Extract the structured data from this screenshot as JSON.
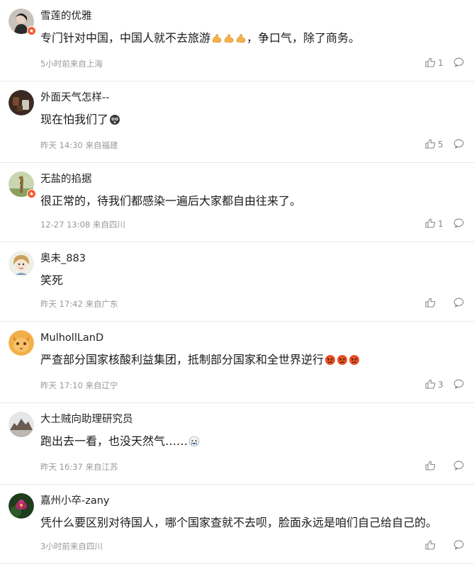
{
  "comments": [
    {
      "username": "雪莲的优雅",
      "text": "专门针对中国，中国人就不去旅游",
      "text_after": "，争口气，除了商务。",
      "emoji": "muscle-emoji",
      "emoji_count": 3,
      "meta": "5小时前来自上海",
      "likes": "1",
      "verified": true,
      "avatar": "woman-portrait"
    },
    {
      "username": "外面天气怎样--",
      "text": "现在怕我们了",
      "text_after": "",
      "emoji": "scared-emoji",
      "emoji_count": 1,
      "meta": "昨天 14:30 来自福建",
      "likes": "5",
      "verified": false,
      "avatar": "dark-photo"
    },
    {
      "username": "无盐的掐据",
      "text": "很正常的，待我们都感染一遍后大家都自由往来了。",
      "text_after": "",
      "emoji": "",
      "emoji_count": 0,
      "meta": "12-27 13:08 来自四川",
      "likes": "1",
      "verified": true,
      "avatar": "giraffe"
    },
    {
      "username": "奥未_883",
      "text": "笑死",
      "text_after": "",
      "emoji": "",
      "emoji_count": 0,
      "meta": "昨天 17:42 来自广东",
      "likes": "",
      "verified": false,
      "avatar": "cartoon-girl"
    },
    {
      "username": "MulhollLanD",
      "text": "严查部分国家核酸利益集团，抵制部分国家和全世界逆行",
      "text_after": "",
      "emoji": "angry-emoji",
      "emoji_count": 3,
      "meta": "昨天 17:10 来自辽宁",
      "likes": "3",
      "verified": false,
      "avatar": "orange-cat"
    },
    {
      "username": "大土贼向助理研究员",
      "text": "跑出去一看，也没天然气……",
      "text_after": "",
      "emoji": "crying-emoji",
      "emoji_count": 1,
      "meta": "昨天 16:37 来自江苏",
      "likes": "",
      "verified": false,
      "avatar": "rock-landscape"
    },
    {
      "username": "嘉州小卒-zany",
      "text": "凭什么要区别对待国人，哪个国家查就不去呗，脸面永远是咱们自己给自己的。",
      "text_after": "",
      "emoji": "",
      "emoji_count": 0,
      "meta": "3小时前来自四川",
      "likes": "",
      "verified": false,
      "avatar": "lotus"
    }
  ],
  "colors": {
    "meta_text": "#999999",
    "username": "#222222",
    "badge": "#f5572a",
    "divider": "#e8e8e8"
  },
  "icons": {
    "like": "thumbs-up-icon",
    "reply": "speech-bubble-icon",
    "badge": "verified-badge-icon"
  }
}
